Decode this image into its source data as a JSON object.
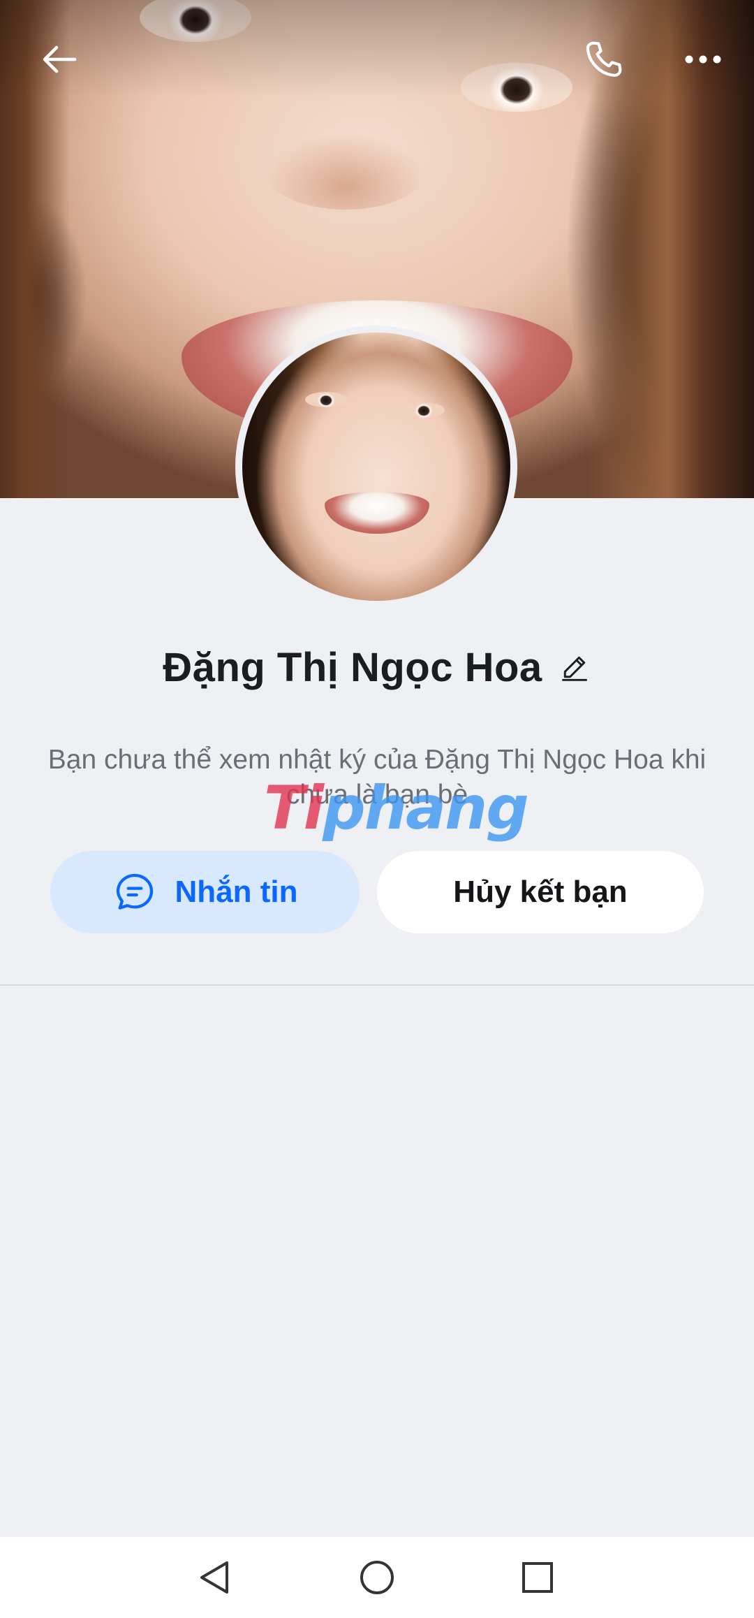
{
  "profile": {
    "name": "Đặng Thị Ngọc Hoa",
    "notice": "Bạn chưa thể xem nhật ký của Đặng Thị Ngọc Hoa khi chưa là bạn bè",
    "watermark_part1": "Ti",
    "watermark_part2": "phang"
  },
  "actions": {
    "message_label": "Nhắn tin",
    "unfriend_label": "Hủy kết bạn"
  },
  "colors": {
    "accent": "#0a68ff",
    "message_button_bg": "#d9e9fd",
    "page_bg": "#eff0f4"
  },
  "icons": {
    "top_left": "back-arrow-icon",
    "top_right": [
      "phone-icon",
      "more-dots-icon"
    ],
    "edit": "pencil-icon",
    "message": "chat-bubble-icon",
    "nav": [
      "nav-back-icon",
      "nav-home-icon",
      "nav-recents-icon"
    ]
  }
}
